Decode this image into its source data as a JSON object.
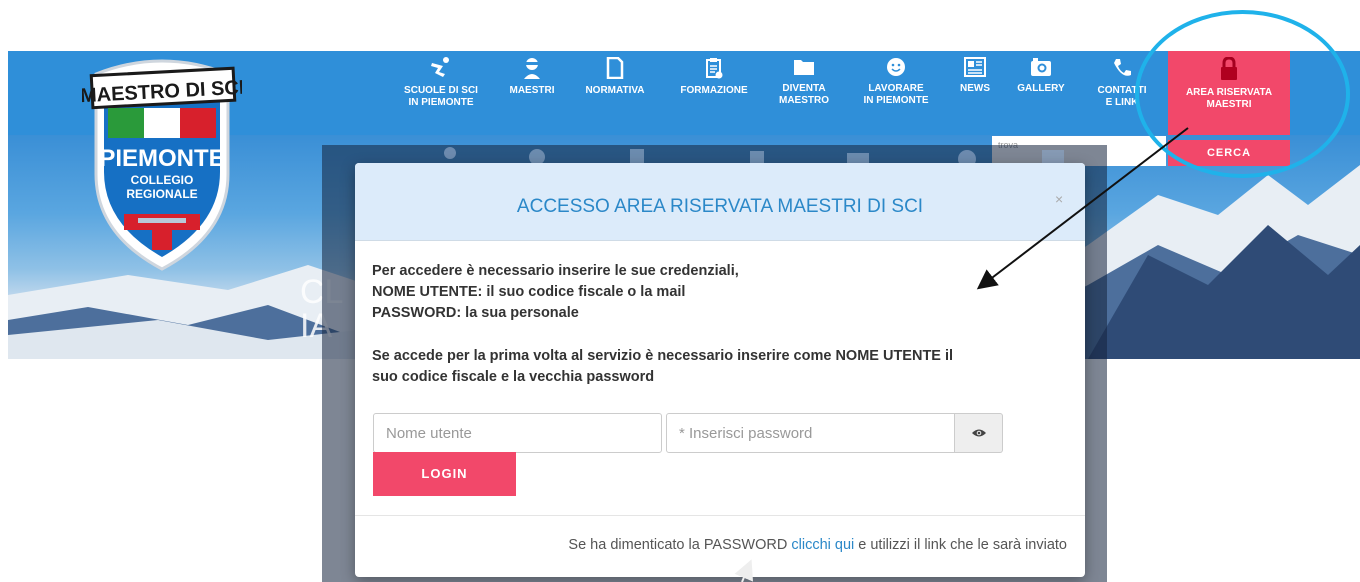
{
  "nav": {
    "items": [
      {
        "label": "SCUOLE DI SCI\nIN PIEMONTE",
        "icon": "skier-icon"
      },
      {
        "label": "MAESTRI",
        "icon": "instructor-icon"
      },
      {
        "label": "NORMATIVA",
        "icon": "document-icon"
      },
      {
        "label": "FORMAZIONE",
        "icon": "clipboard-icon"
      },
      {
        "label": "DIVENTA\nMAESTRO",
        "icon": "folder-icon"
      },
      {
        "label": "LAVORARE\nIN PIEMONTE",
        "icon": "smiley-icon"
      },
      {
        "label": "NEWS",
        "icon": "newspaper-icon"
      },
      {
        "label": "GALLERY",
        "icon": "camera-icon"
      },
      {
        "label": "CONTATTI\nE LINK",
        "icon": "phone-icon"
      }
    ],
    "reserved": {
      "label": "AREA RISERVATA\nMAESTRI",
      "icon": "lock-icon"
    },
    "search_button": "CERCA",
    "search_placeholder": "trova"
  },
  "logo": {
    "top_text": "MAESTRO DI SCI",
    "region": "PIEMONTE",
    "sub1": "COLLEGIO",
    "sub2": "REGIONALE"
  },
  "hero": {
    "partial_text": "CL\nIA"
  },
  "modal": {
    "title": "ACCESSO AREA RISERVATA MAESTRI DI SCI",
    "close": "×",
    "line1": "Per accedere è necessario inserire le sue credenziali,",
    "line2": "NOME UTENTE: il suo codice fiscale o la mail",
    "line3": "PASSWORD: la sua personale",
    "line4": "Se accede per la prima volta al servizio è necessario inserire come NOME UTENTE il",
    "line5": "suo codice fiscale e la vecchia password",
    "username_placeholder": "Nome utente",
    "password_placeholder": "* Inserisci password",
    "login_label": "LOGIN",
    "footer_before": "Se ha dimenticato la PASSWORD ",
    "footer_link": "clicchi qui",
    "footer_after": " e utilizzi il link che le sarà inviato"
  },
  "colors": {
    "nav_blue": "#2f8fd9",
    "accent_pink": "#f2486a",
    "title_blue": "#2b88c8",
    "highlight_cyan": "#1fb2ea"
  }
}
